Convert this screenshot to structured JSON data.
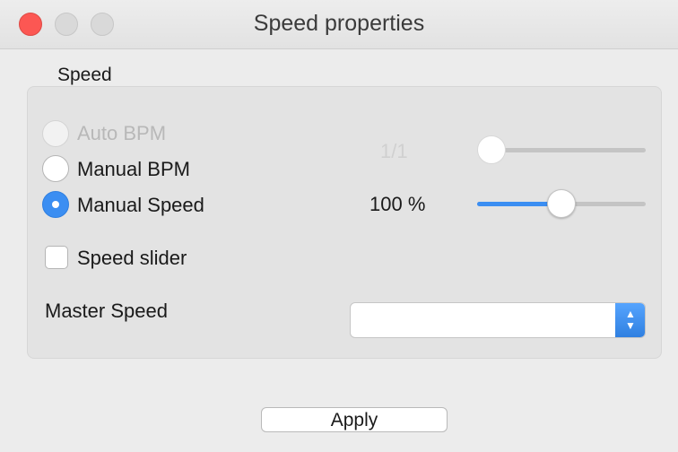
{
  "window": {
    "title": "Speed properties"
  },
  "group": {
    "label": "Speed"
  },
  "options": {
    "auto_bpm": "Auto BPM",
    "manual_bpm": "Manual BPM",
    "manual_speed": "Manual Speed",
    "selected": "Manual Speed"
  },
  "ratio": {
    "value": "1/1",
    "slider_level": 0.0
  },
  "speed": {
    "value": "100 %",
    "slider_level": 0.5
  },
  "speed_slider": {
    "label": "Speed slider",
    "checked": false
  },
  "master_speed": {
    "label": "Master Speed",
    "value": ""
  },
  "footer": {
    "apply_label": "Apply"
  },
  "colors": {
    "accent": "#3b8ef2",
    "close": "#fc5753"
  }
}
